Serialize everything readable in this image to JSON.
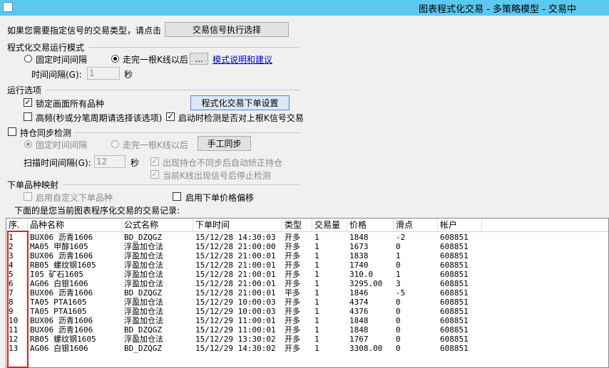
{
  "window": {
    "title": "图表程式化交易 - 多策略模型 - 交易中"
  },
  "signal_type": {
    "prompt": "如果您需要指定信号的交易类型，请点击",
    "button": "交易信号执行选择"
  },
  "run_mode": {
    "title": "程式化交易运行模式",
    "fixed_interval": "固定时间间隔",
    "after_bar": "走完一根K线以后",
    "ellipsis_button": "...",
    "help_link": "模式说明和建议",
    "interval_label": "时间间隔(G):",
    "interval_value": "1",
    "interval_unit": "秒"
  },
  "run_options": {
    "title": "运行选项",
    "lock_all": "锁定画面所有品种",
    "order_settings_button": "程式化交易下单设置",
    "high_freq": "高频(秒或分笔周期请选择该选项)",
    "startup_check": "启动时检测是否对上根K信号交易"
  },
  "position_sync": {
    "title": "持仓同步检测",
    "fixed_interval": "固定时间间隔",
    "after_bar": "走完一根K线以后",
    "manual_sync_button": "手工同步",
    "scan_label": "扫描时间间隔(G):",
    "scan_value": "12",
    "scan_unit": "秒",
    "auto_correct": "出现持仓不同步后自动矫正持仓",
    "stop_check": "当前K线出现信号后停止检测"
  },
  "order_mapping": {
    "title": "下单品种映射",
    "custom_symbol": "启用自定义下单品种",
    "price_offset": "启用下单价格偏移"
  },
  "records_label": "下面的是您当前图表程序化交易的交易记录:",
  "table": {
    "columns": [
      "序.",
      "品种名称",
      "公式名称",
      "下单时间",
      "类型",
      "交易量",
      "价格",
      "滑点",
      "帐户"
    ],
    "rows": [
      [
        "1",
        "BUX06 沥青1606",
        "BD_DZQGZ",
        "15/12/28 14:30:03",
        "开多",
        "1",
        "1848",
        "-2",
        "608851"
      ],
      [
        "2",
        "MA05 甲醇1605",
        "浮盈加仓法",
        "15/12/28 21:00:00",
        "开多",
        "1",
        "1673",
        "0",
        "608851"
      ],
      [
        "3",
        "BUX06 沥青1606",
        "浮盈加仓法",
        "15/12/28 21:00:01",
        "开多",
        "1",
        "1838",
        "1",
        "608851"
      ],
      [
        "4",
        "RB05 螺纹钢1605",
        "浮盈加仓法",
        "15/12/28 21:00:01",
        "开多",
        "1",
        "1740",
        "0",
        "608851"
      ],
      [
        "5",
        "I05 矿石1605",
        "浮盈加仓法",
        "15/12/28 21:00:01",
        "开多",
        "1",
        "310.0",
        "1",
        "608851"
      ],
      [
        "6",
        "AG06 白银1606",
        "浮盈加仓法",
        "15/12/28 21:00:01",
        "开多",
        "1",
        "3295.00",
        "3",
        "608851"
      ],
      [
        "7",
        "BUX06 沥青1606",
        "BD_DZQGZ",
        "15/12/28 21:00:01",
        "平多",
        "1",
        "1846",
        "-5",
        "608851"
      ],
      [
        "8",
        "TA05 PTA1605",
        "浮盈加仓法",
        "15/12/29 10:00:03",
        "开多",
        "1",
        "4374",
        "0",
        "608851"
      ],
      [
        "9",
        "TA05 PTA1605",
        "浮盈加仓法",
        "15/12/29 10:00:03",
        "开多",
        "1",
        "4376",
        "0",
        "608851"
      ],
      [
        "10",
        "BUX06 沥青1606",
        "浮盈加仓法",
        "15/12/29 11:00:01",
        "开多",
        "1",
        "1848",
        "0",
        "608851"
      ],
      [
        "11",
        "BUX06 沥青1606",
        "BD_DZQGZ",
        "15/12/29 11:00:01",
        "开多",
        "1",
        "1848",
        "0",
        "608851"
      ],
      [
        "12",
        "RB05 螺纹钢1605",
        "浮盈加仓法",
        "15/12/29 13:30:02",
        "开多",
        "1",
        "1767",
        "0",
        "608851"
      ],
      [
        "13",
        "AG06 白银1606",
        "BD_DZQGZ",
        "15/12/29 14:30:02",
        "开多",
        "1",
        "3308.00",
        "0",
        "608851"
      ]
    ]
  }
}
